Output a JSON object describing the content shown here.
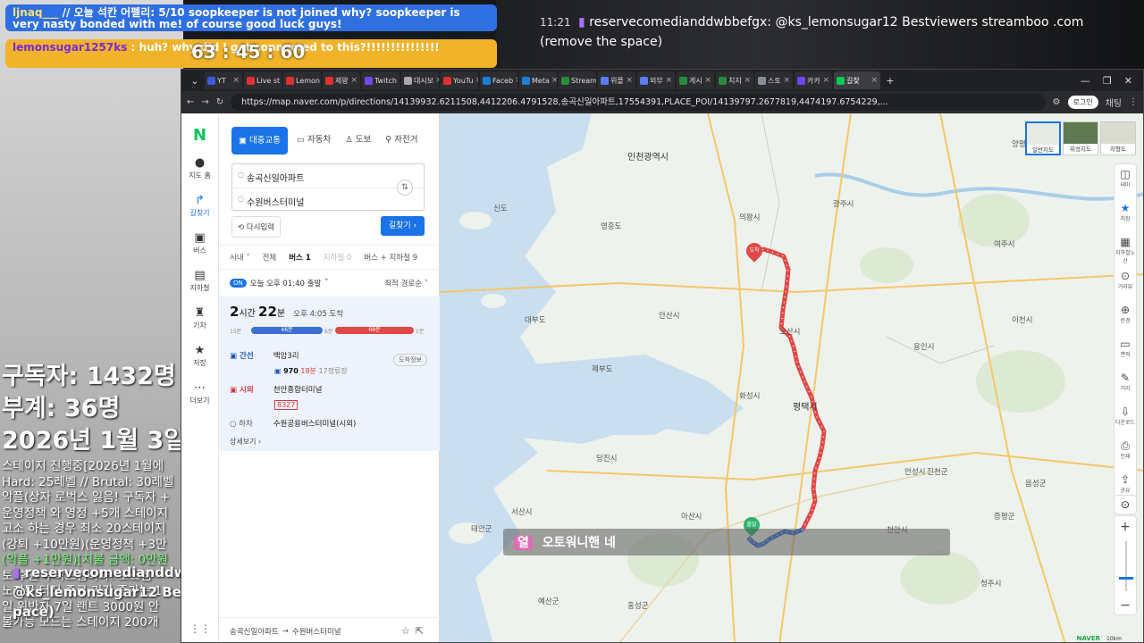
{
  "stream": {
    "chat_top_1": {
      "name": "ljnaq___",
      "text": "// 오늘 석칸 어펠리: 5/10 soopkeeper is not joined why? soopkeeper is very nasty bonded with me! of course good luck guys!"
    },
    "chat_top_2": {
      "name": "lemonsugar1257ks",
      "text": ": huh? why did I get connected to this?!!!!!!!!!!!!!!!"
    },
    "counter": "63 : 45 : 60",
    "right_chat": {
      "time": "11:21",
      "user": "reservecomedianddwbbefgx:",
      "text": "@ks_lemonsugar12 Bestviewers streamboo .com (remove the space)"
    },
    "stats": {
      "subscribers": "구독자: 1432명",
      "sub2": "부계: 36명",
      "date": "2026년 1월 3일"
    },
    "rules": [
      "스테이지 진행중[2026년 1월에",
      "Hard: 25레벨 // Brutal: 30레벨",
      "악플(상자 로벅스 잃음! 구독자 +",
      "운영정책 와 영정 +5개 스테이지",
      "고소 하는 경우 최소 20스테이지",
      "(강퇴 +10만원)(운영정책 +3만",
      "(악플 +1만원)[지불 금액: 0만원",
      "토 후원 부탁드립니다! 도스쌤",
      "노지물 터진 종료 기간 증가는 1",
      "일 위반자 7일 랜트 3000원 안",
      "불가능 모드는 스테이지 200개"
    ],
    "bottom_chat": {
      "user": "reservecomedianddw",
      "text": "@ks_lemonsugar12 Bes",
      "text2": "pace)"
    }
  },
  "browser": {
    "tabs": [
      {
        "label": "YT",
        "color": "#3b5bdb"
      },
      {
        "label": "Live st",
        "color": "#e03131"
      },
      {
        "label": "Lemon",
        "color": "#e03131"
      },
      {
        "label": "제왕",
        "color": "#e03131"
      },
      {
        "label": "Twitch",
        "color": "#7048e8"
      },
      {
        "label": "대시보",
        "color": "#aaaaaa"
      },
      {
        "label": "YouTu",
        "color": "#e03131"
      },
      {
        "label": "Faceb",
        "color": "#1c7ed6"
      },
      {
        "label": "Meta",
        "color": "#1c7ed6"
      },
      {
        "label": "Stream",
        "color": "#2b8a3e"
      },
      {
        "label": "위플",
        "color": "#5c7cfa"
      },
      {
        "label": "외부",
        "color": "#5c7cfa"
      },
      {
        "label": "게시",
        "color": "#2b8a3e"
      },
      {
        "label": "치지",
        "color": "#2b8a3e"
      },
      {
        "label": "스토",
        "color": "#868e96"
      },
      {
        "label": "카카",
        "color": "#7048e8"
      },
      {
        "label": "길찾",
        "color": "#03c75a"
      }
    ],
    "url": "https://map.naver.com/p/directions/14139932.6211508,4412206.4791528,송곡신일아파트,17554391,PLACE_POI/14139797.2677819,4474197.6754229,...",
    "login": "로그인",
    "profile": "채팅"
  },
  "nav": {
    "logo": "N",
    "items": [
      {
        "icon": "●",
        "label": "지도 홈"
      },
      {
        "icon": "↱",
        "label": "길찾기"
      },
      {
        "icon": "▣",
        "label": "버스"
      },
      {
        "icon": "▤",
        "label": "지하철"
      },
      {
        "icon": "♜",
        "label": "기차"
      },
      {
        "icon": "★",
        "label": "저장"
      },
      {
        "icon": "⋯",
        "label": "더보기"
      }
    ]
  },
  "panel": {
    "modes": [
      "대중교통",
      "자동차",
      "도보",
      "자전거"
    ],
    "origin": "송곡신일아파트",
    "destination": "수원버스터미널",
    "reset": "다시입력",
    "search": "길찾기",
    "filters": [
      "시내",
      "전체",
      "버스 1",
      "지하철 0",
      "버스 + 지하철 9"
    ],
    "depart_badge": "ON",
    "depart_text": "오늘 오후 01:40 출발",
    "sort": "최적 경로순",
    "duration_h": "2",
    "duration_h_unit": "시간",
    "duration_m": "22",
    "duration_m_unit": "분",
    "arrival": "오후 4:05 도착",
    "timeline": {
      "walk1": "15분",
      "bus1": "46분",
      "gap": "6분",
      "bus2": "68분",
      "walk2": "1분"
    },
    "legs": [
      {
        "kind": "간선",
        "stop": "백암3리",
        "bus": "970",
        "note": "18분",
        "extra": "17정류장"
      },
      {
        "kind": "시외",
        "stop": "천안종합터미널",
        "bus": "8327"
      },
      {
        "kind": "하차",
        "stop": "수원공용버스터미널(시외)"
      }
    ],
    "station_info": "도착정보",
    "more": "상세보기",
    "footer_from": "송곡신일아파트",
    "footer_to": "수원버스터미널"
  },
  "map": {
    "types": [
      "일반지도",
      "위성지도",
      "지형도"
    ],
    "tools": [
      {
        "icon": "◫",
        "label": "테마"
      },
      {
        "icon": "★",
        "label": "저장"
      },
      {
        "icon": "▦",
        "label": "지하철노선"
      },
      {
        "icon": "⊙",
        "label": "거리뷰"
      },
      {
        "icon": "⊕",
        "label": "반경"
      },
      {
        "icon": "▭",
        "label": "면적"
      },
      {
        "icon": "✎",
        "label": "거리"
      },
      {
        "icon": "⇩",
        "label": "다운로드"
      },
      {
        "icon": "⎙",
        "label": "인쇄"
      },
      {
        "icon": "⇪",
        "label": "공유"
      }
    ],
    "labels": [
      {
        "t": "인천광역시",
        "big": true
      },
      {
        "t": "양평군"
      },
      {
        "t": "광주시"
      },
      {
        "t": "의왕시"
      },
      {
        "t": "용인시"
      },
      {
        "t": "이천시"
      },
      {
        "t": "여주시"
      },
      {
        "t": "안산시"
      },
      {
        "t": "평택시",
        "big": true
      },
      {
        "t": "안성시"
      },
      {
        "t": "당진시"
      },
      {
        "t": "아산시"
      },
      {
        "t": "천안시"
      },
      {
        "t": "진천군"
      },
      {
        "t": "서산시"
      },
      {
        "t": "예산군"
      },
      {
        "t": "증평군"
      },
      {
        "t": "음성군"
      },
      {
        "t": "태안군"
      },
      {
        "t": "홍성군"
      },
      {
        "t": "청주시"
      },
      {
        "t": "대부도"
      },
      {
        "t": "제부도"
      },
      {
        "t": "화성시"
      },
      {
        "t": "오산시"
      },
      {
        "t": "신도"
      },
      {
        "t": "영흥도"
      }
    ],
    "origin_pin": "출발",
    "dest_pin": "도착",
    "subtitle_tag": "열",
    "subtitle": "오토워니핸 네",
    "brand": "NAVER",
    "scale": "10km"
  }
}
